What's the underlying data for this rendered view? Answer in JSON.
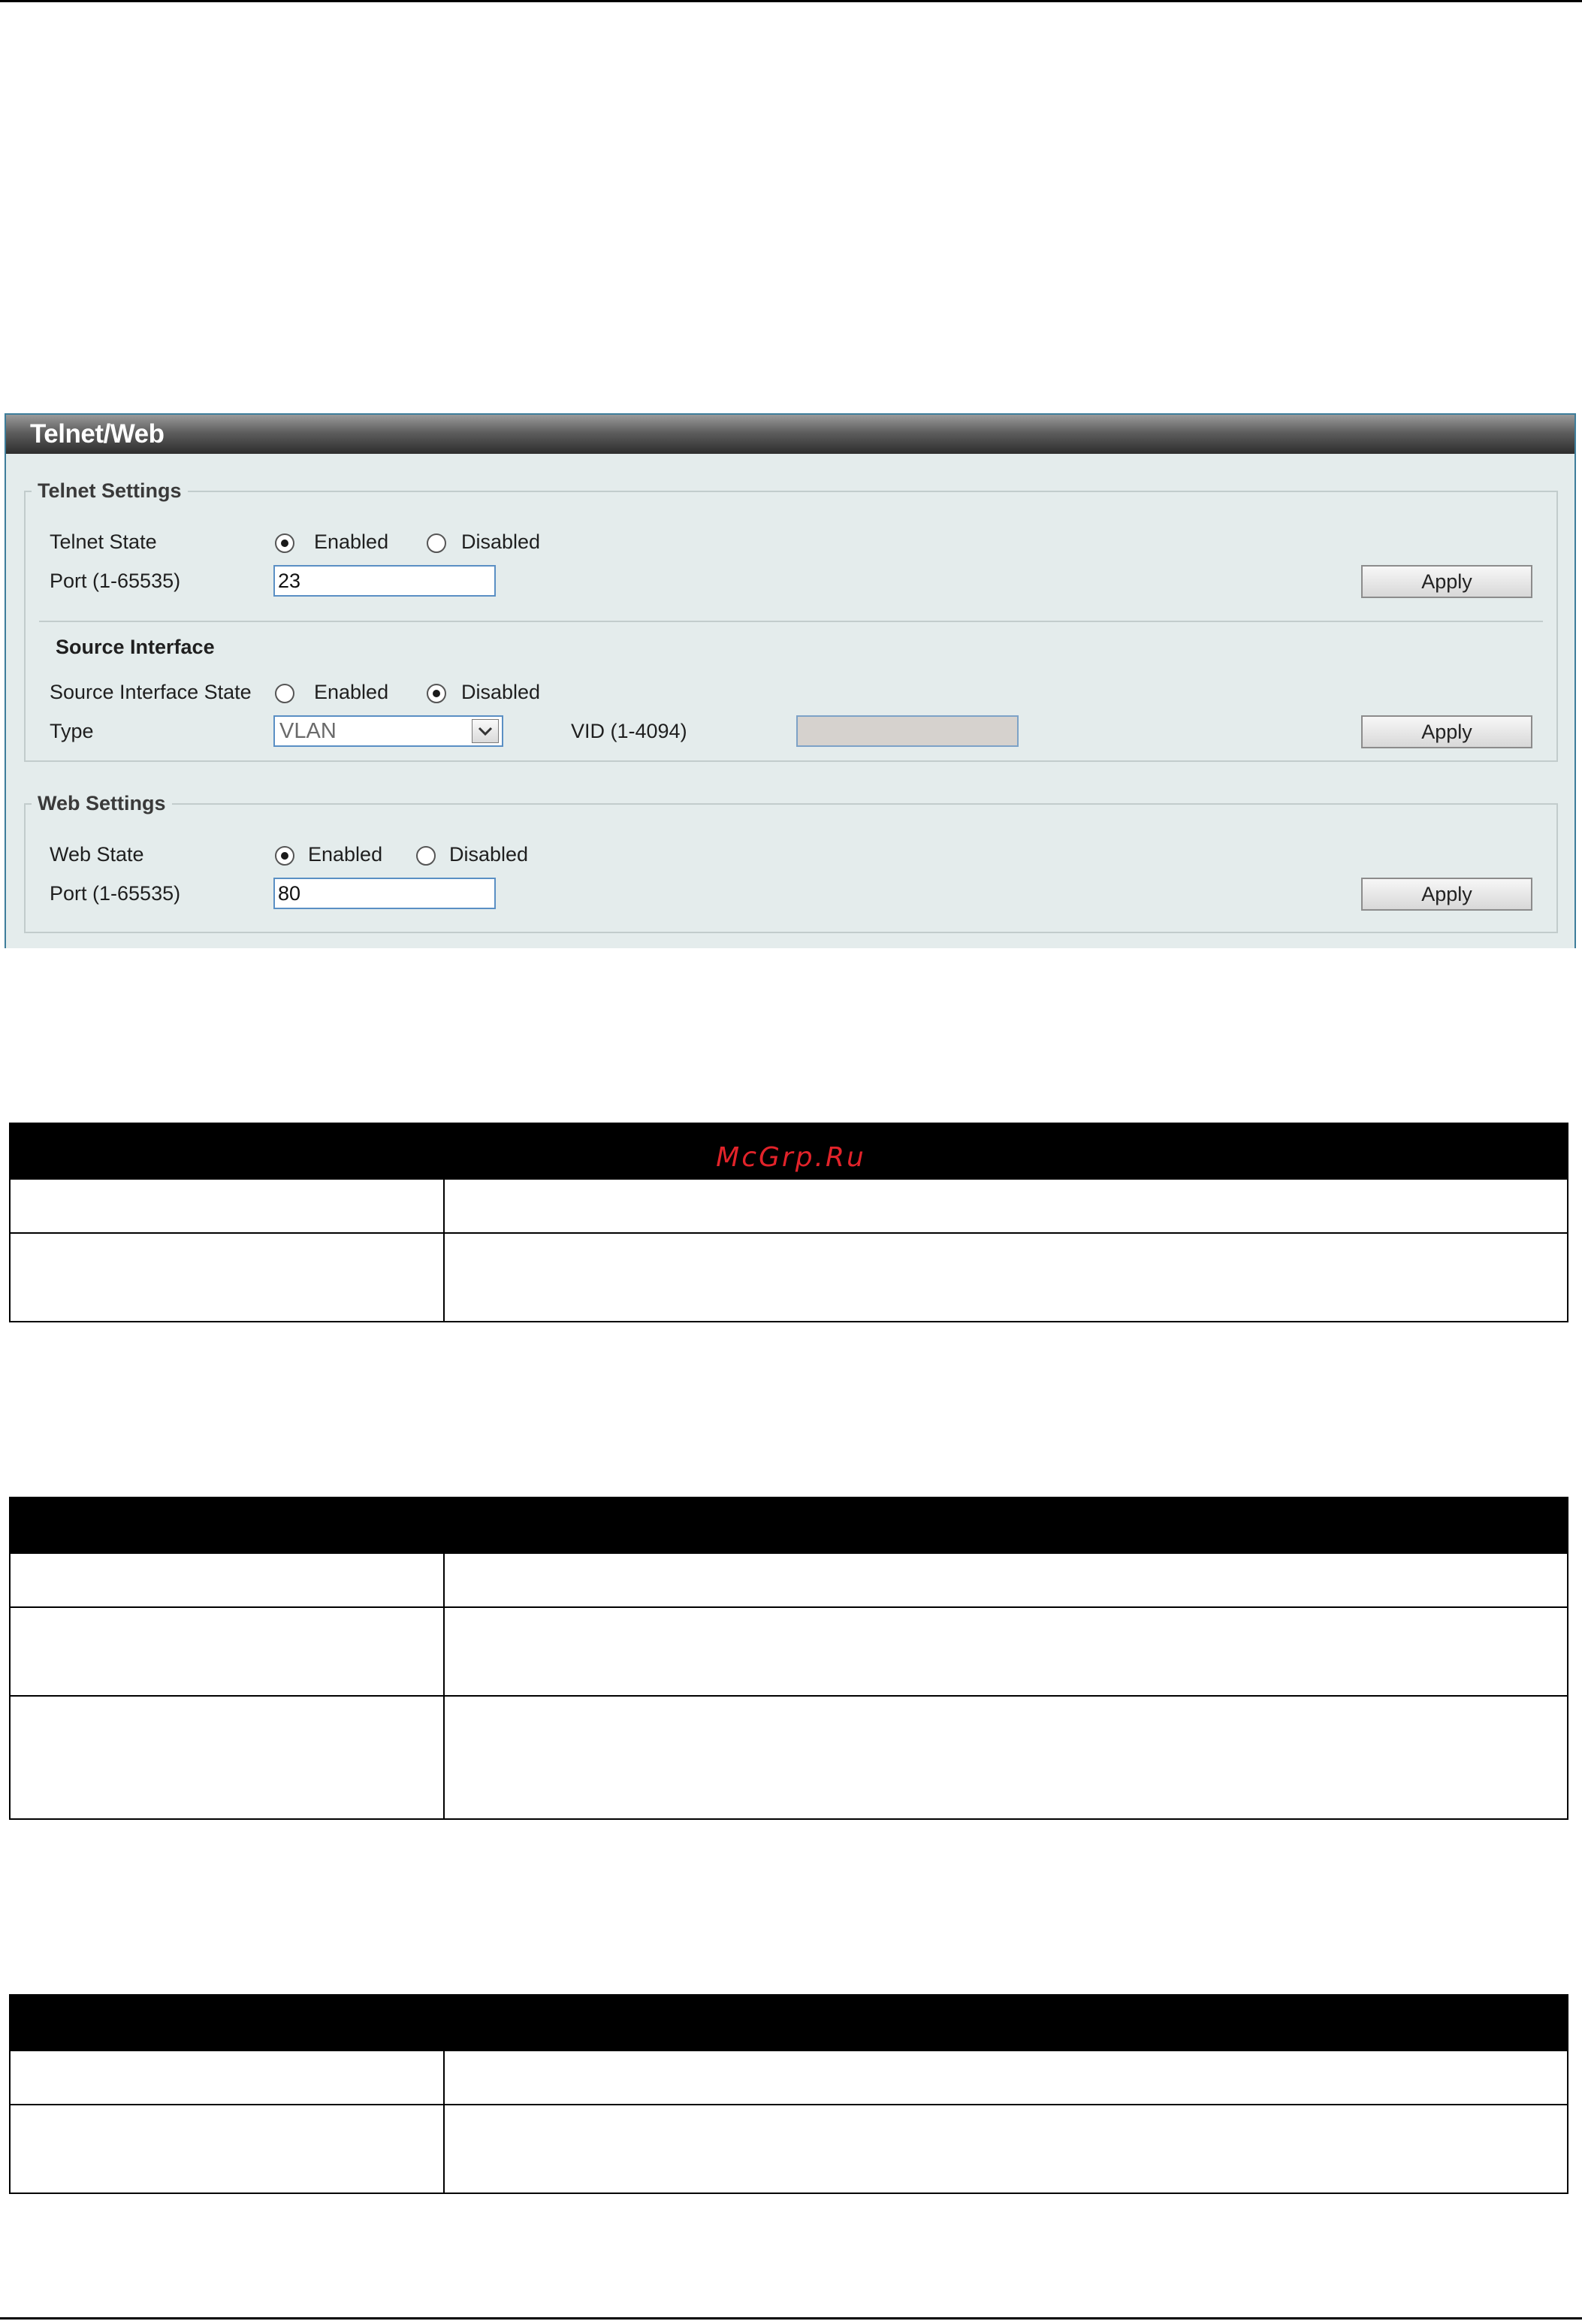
{
  "panel": {
    "title": "Telnet/Web",
    "telnet_settings": {
      "legend": "Telnet Settings",
      "state_label": "Telnet State",
      "state_options": [
        "Enabled",
        "Disabled"
      ],
      "state_selected": "Enabled",
      "port_label": "Port (1-65535)",
      "port_value": "23",
      "apply_label": "Apply"
    },
    "source_interface": {
      "heading": "Source Interface",
      "state_label": "Source Interface State",
      "state_options": [
        "Enabled",
        "Disabled"
      ],
      "state_selected": "Disabled",
      "type_label": "Type",
      "type_value": "VLAN",
      "vid_label": "VID (1-4094)",
      "vid_value": "",
      "apply_label": "Apply"
    },
    "web_settings": {
      "legend": "Web Settings",
      "state_label": "Web State",
      "state_options": [
        "Enabled",
        "Disabled"
      ],
      "state_selected": "Enabled",
      "port_label": "Port (1-65535)",
      "port_value": "80",
      "apply_label": "Apply"
    }
  },
  "watermark": "McGrp.Ru",
  "tables": [
    {
      "rows": 2
    },
    {
      "rows": 3
    },
    {
      "rows": 2
    }
  ],
  "colors": {
    "panel_background": "#e4ecec",
    "panel_border": "#3d7d9a",
    "title_bar": "#3a3a3a",
    "input_border": "#5a8fc4",
    "watermark": "#e2232a",
    "table_header": "#000000"
  }
}
